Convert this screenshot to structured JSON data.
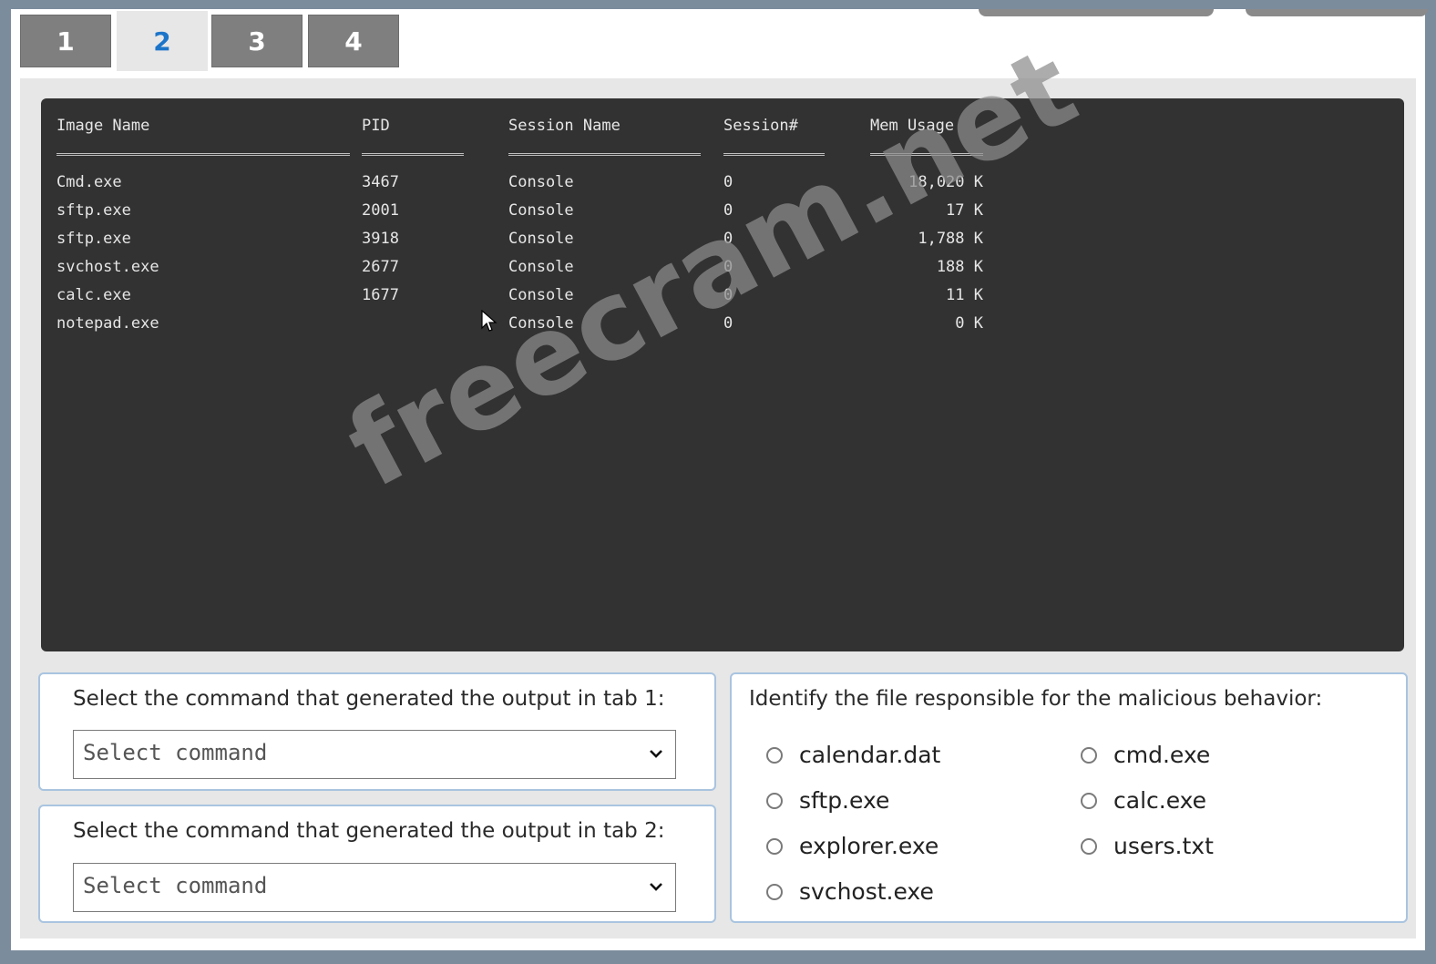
{
  "tabs": [
    {
      "label": "1",
      "active": false
    },
    {
      "label": "2",
      "active": true
    },
    {
      "label": "3",
      "active": false
    },
    {
      "label": "4",
      "active": false
    }
  ],
  "terminal": {
    "headers": [
      "Image Name",
      "PID",
      "Session Name",
      "Session#",
      "Mem Usage"
    ],
    "separators": [
      "=========================",
      "=========",
      "=================",
      "=========",
      "=========="
    ],
    "rows": [
      {
        "image": "Cmd.exe",
        "pid": "3467",
        "session_name": "Console",
        "session_num": "0",
        "mem": "18,020 K"
      },
      {
        "image": "sftp.exe",
        "pid": "2001",
        "session_name": "Console",
        "session_num": "0",
        "mem": "17 K"
      },
      {
        "image": "sftp.exe",
        "pid": "3918",
        "session_name": "Console",
        "session_num": "0",
        "mem": "1,788 K"
      },
      {
        "image": "svchost.exe",
        "pid": "2677",
        "session_name": "Console",
        "session_num": "0",
        "mem": "188 K"
      },
      {
        "image": "calc.exe",
        "pid": "1677",
        "session_name": "Console",
        "session_num": "0",
        "mem": "11 K"
      },
      {
        "image": "notepad.exe",
        "pid": "",
        "session_name": "Console",
        "session_num": "0",
        "mem": "0 K"
      }
    ]
  },
  "questions": {
    "q1": {
      "prompt": "Select the command that generated the output in tab 1:",
      "select_value": "Select command"
    },
    "q2": {
      "prompt": "Select the command that generated the output in tab 2:",
      "select_value": "Select command"
    },
    "q3": {
      "prompt": "Identify the file responsible for the malicious behavior:",
      "options": [
        "calendar.dat",
        "cmd.exe",
        "sftp.exe",
        "calc.exe",
        "explorer.exe",
        "users.txt",
        "svchost.exe"
      ]
    }
  },
  "watermark": "freecram.net",
  "colors": {
    "accent": "#1c75c9",
    "terminal_bg": "#323232",
    "panel_border": "#a9c4e0",
    "tab_inactive": "#7f7f7f"
  }
}
